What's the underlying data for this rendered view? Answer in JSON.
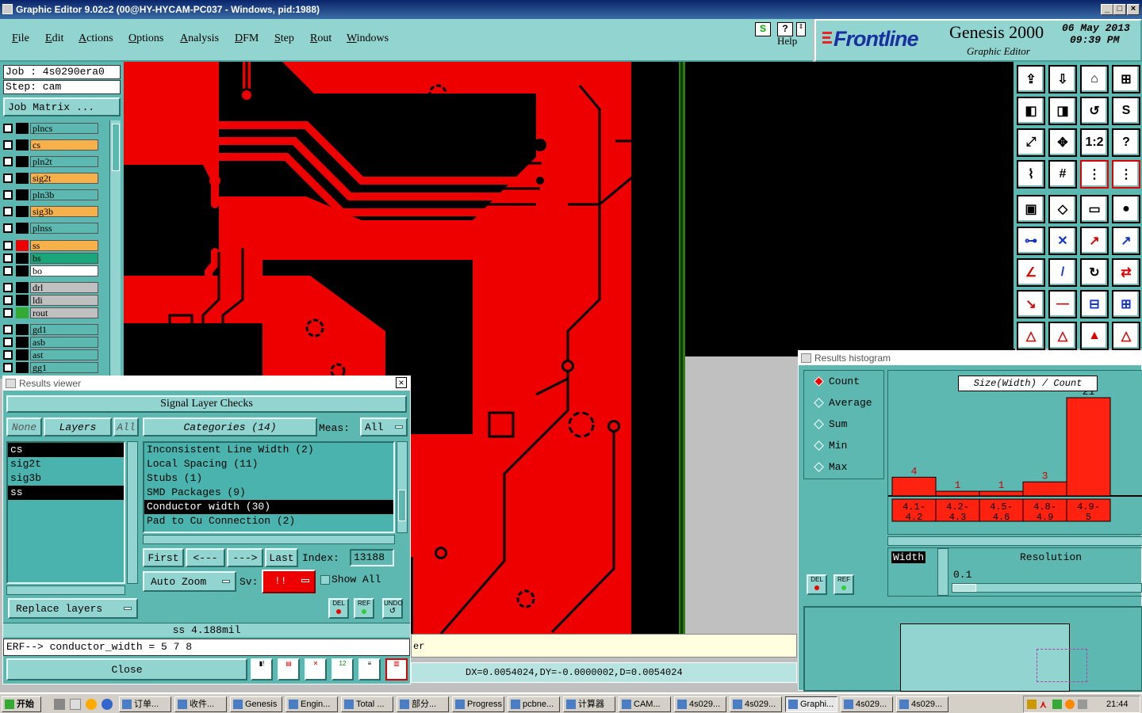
{
  "window": {
    "title": "Graphic Editor 9.02c2 (00@HY-HYCAM-PC037 - Windows, pid:1988)"
  },
  "menu": [
    "File",
    "Edit",
    "Actions",
    "Options",
    "Analysis",
    "DFM",
    "Step",
    "Rout",
    "Windows"
  ],
  "help_label": "Help",
  "brand": {
    "logo": "Frontline",
    "product": "Genesis 2000",
    "subtitle": "Graphic Editor",
    "date": "06 May 2013",
    "time": "09:39 PM"
  },
  "job": {
    "job_label": "Job  : 4s0290era0",
    "step_label": "Step: cam",
    "matrix_button": "Job Matrix ..."
  },
  "layers": [
    {
      "name": "plncs",
      "color": "#5cb8b1"
    },
    {
      "name": "cs",
      "color": "#f7b14a"
    },
    {
      "name": "pln2t",
      "color": "#5cb8b1"
    },
    {
      "name": "sig2t",
      "color": "#f7b14a"
    },
    {
      "name": "pln3b",
      "color": "#5cb8b1"
    },
    {
      "name": "sig3b",
      "color": "#f7b14a"
    },
    {
      "name": "plnss",
      "color": "#5cb8b1"
    },
    {
      "name": "ss",
      "color": "#f7b14a"
    },
    {
      "name": "bs",
      "color": "#1aa57a"
    },
    {
      "name": "bo",
      "color": "#ffffff"
    },
    {
      "name": "drl",
      "color": "#c0c0c0"
    },
    {
      "name": "ldi",
      "color": "#c0c0c0"
    },
    {
      "name": "rout",
      "color": "#c0c0c0"
    },
    {
      "name": "gd1",
      "color": "#5cb8b1"
    },
    {
      "name": "asb",
      "color": "#5cb8b1"
    },
    {
      "name": "ast",
      "color": "#5cb8b1"
    },
    {
      "name": "gg1",
      "color": "#5cb8b1"
    }
  ],
  "results_viewer": {
    "title": "Results viewer",
    "header": "Signal Layer Checks",
    "none_btn": "None",
    "layers_btn": "Layers",
    "all_btn": "All",
    "categories_btn": "Categories (14)",
    "meas_label": "Meas:",
    "meas_value": "All",
    "layer_list": [
      {
        "name": "cs",
        "selected": true
      },
      {
        "name": "sig2t",
        "selected": false
      },
      {
        "name": "sig3b",
        "selected": false
      },
      {
        "name": "ss",
        "selected": true
      }
    ],
    "categories": [
      {
        "name": "Inconsistent Line Width (2)",
        "selected": false
      },
      {
        "name": "Local Spacing (11)",
        "selected": false
      },
      {
        "name": "Stubs (1)",
        "selected": false
      },
      {
        "name": "SMD Packages (9)",
        "selected": false
      },
      {
        "name": "Conductor width (30)",
        "selected": true
      },
      {
        "name": "Pad to Cu Connection (2)",
        "selected": false
      }
    ],
    "first": "First",
    "prev": "<---",
    "next": "--->",
    "last": "Last",
    "index_label": "Index:",
    "index_value": "13188",
    "auto_zoom": "Auto Zoom",
    "sv_label": "Sv:",
    "sv_value": "!!",
    "show_all": "Show All",
    "replace_layers": "Replace layers",
    "del": "DEL",
    "ref": "REF",
    "undo": "UNDO",
    "status": "ss 4.188mil",
    "erf": "ERF--> conductor_width = 5 7 8",
    "close": "Close"
  },
  "coord_readout": "DX=0.0054024,DY=-0.0000002,D=0.0054024",
  "status_tail": "er",
  "histogram": {
    "title": "Results histogram",
    "modes": [
      {
        "name": "Count",
        "on": true
      },
      {
        "name": "Average",
        "on": false
      },
      {
        "name": "Sum",
        "on": false
      },
      {
        "name": "Min",
        "on": false
      },
      {
        "name": "Max",
        "on": false
      }
    ],
    "axis_title": "Size(Width) / Count",
    "width_label": "Width",
    "resolution_label": "Resolution",
    "resolution_value": "0.1",
    "del": "DEL",
    "ref": "REF"
  },
  "chart_data": {
    "type": "bar",
    "title": "Size(Width) / Count",
    "categories": [
      "4.1-4.2",
      "4.2-4.3",
      "4.5-4.6",
      "4.8-4.9",
      "4.9-5"
    ],
    "values": [
      4,
      1,
      1,
      3,
      21
    ],
    "ylim": [
      0,
      21
    ]
  },
  "taskbar": {
    "start": "开始",
    "items": [
      "订单...",
      "收件...",
      "Genesis",
      "Engin...",
      "Total ...",
      "部分...",
      "Progress",
      "pcbne...",
      "计算器",
      "CAM...",
      "4s029...",
      "4s029...",
      "Graphi...",
      "4s029...",
      "4s029..."
    ],
    "active": "Graphi...",
    "clock": "21:44"
  }
}
